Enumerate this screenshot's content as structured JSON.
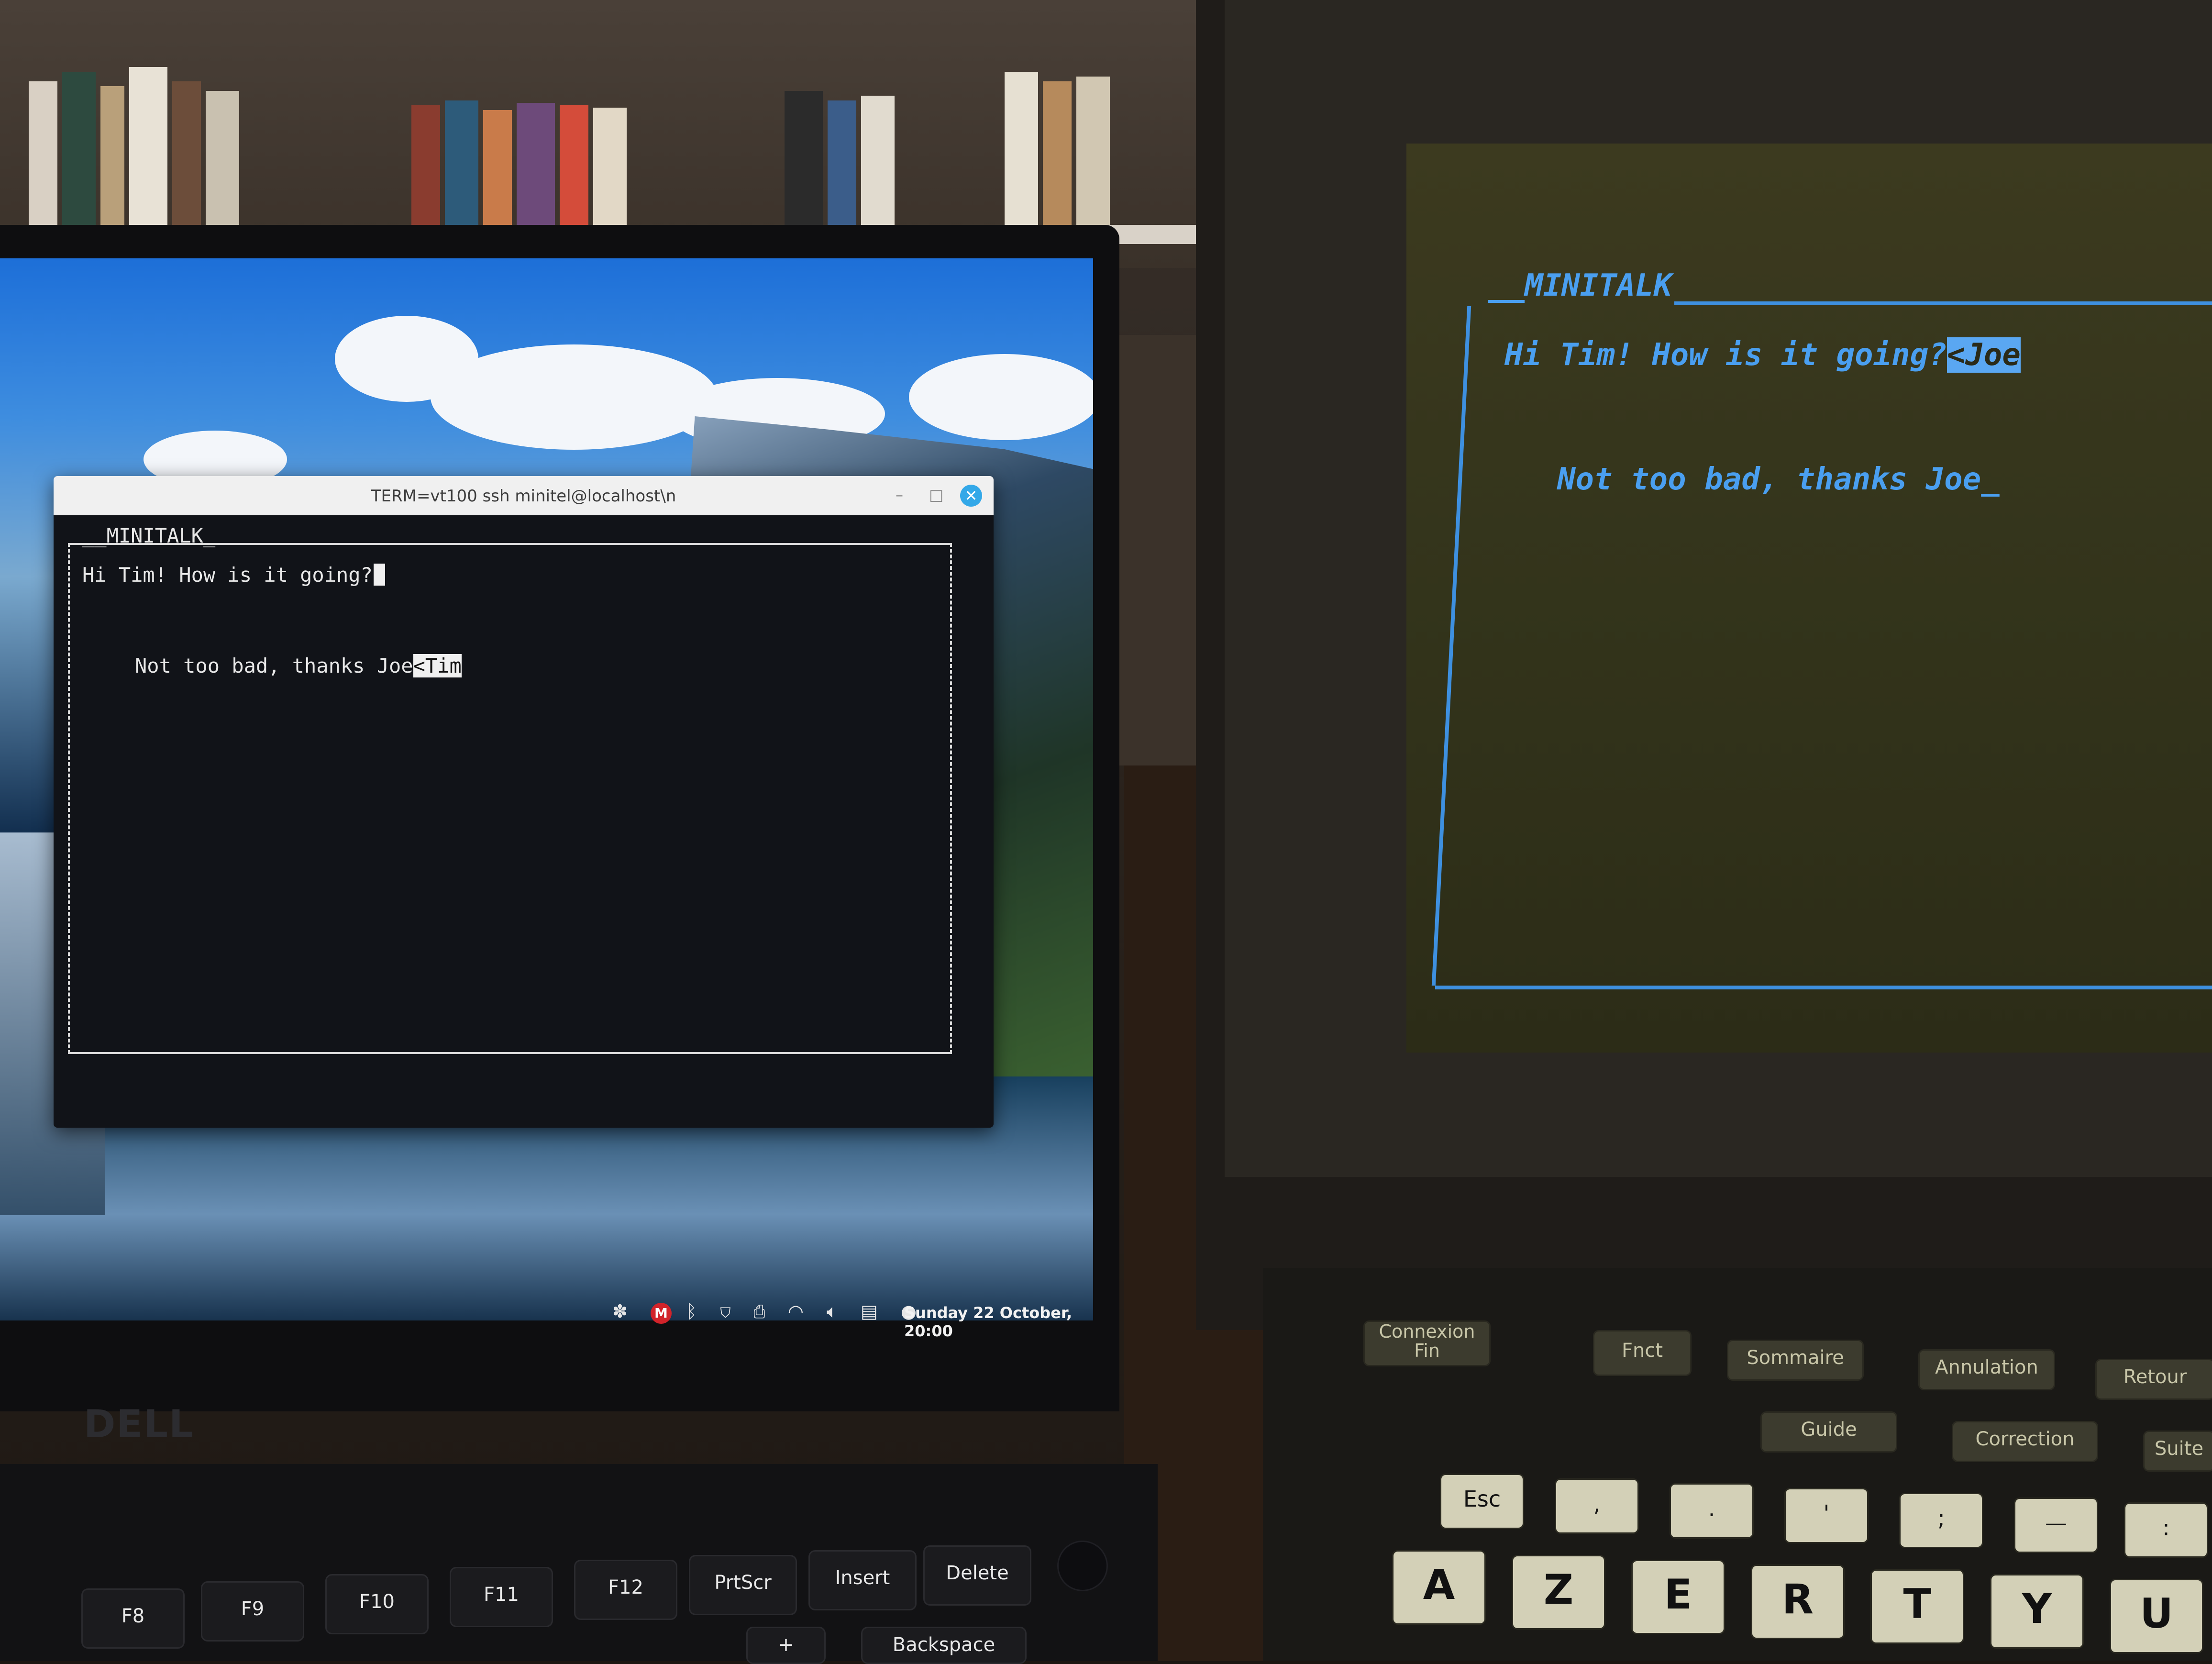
{
  "terminal": {
    "title": "TERM=vt100 ssh minitel@localhost\\n",
    "minimize_glyph": "–",
    "maximize_glyph": "□",
    "close_glyph": "✕",
    "app_heading": "__MINITALK_",
    "message_in": "Hi Tim! How is it going?",
    "message_out": "Not too bad, thanks Joe",
    "reverse_tag": "<Tim"
  },
  "taskbar": {
    "icons": [
      "slack-icon",
      "gmail-icon",
      "bluetooth-icon",
      "shield-icon",
      "printer-icon",
      "wifi-icon",
      "volume-icon",
      "clipboard-icon",
      "user-icon"
    ],
    "mail_badge": "M",
    "clock": "Sunday 22 October, 20:00"
  },
  "laptop": {
    "brand": "DELL",
    "keys": [
      "F8",
      "F9",
      "F10",
      "F11",
      "F12",
      "PrtScr",
      "Insert",
      "Delete",
      "+",
      "Backspace"
    ]
  },
  "minitel": {
    "app_heading": "__MINITALK",
    "message_in": "Hi Tim! How is it going?",
    "reverse_tag": "<Joe",
    "message_out": "Not too bad, thanks Joe_",
    "function_keys": [
      "Connexion Fin",
      "Fnct",
      "Sommaire",
      "Annulation",
      "Retour",
      "Guide",
      "Correction",
      "Suite"
    ],
    "symbol_keys": [
      "Esc",
      ",",
      ".",
      "'",
      ";",
      "—",
      ":"
    ],
    "letter_keys": [
      "A",
      "Z",
      "E",
      "R",
      "T",
      "Y",
      "U"
    ]
  },
  "colors": {
    "minitel_text": "#4a9ff0",
    "terminal_bg": "#111318",
    "close_button": "#33a8e8"
  }
}
